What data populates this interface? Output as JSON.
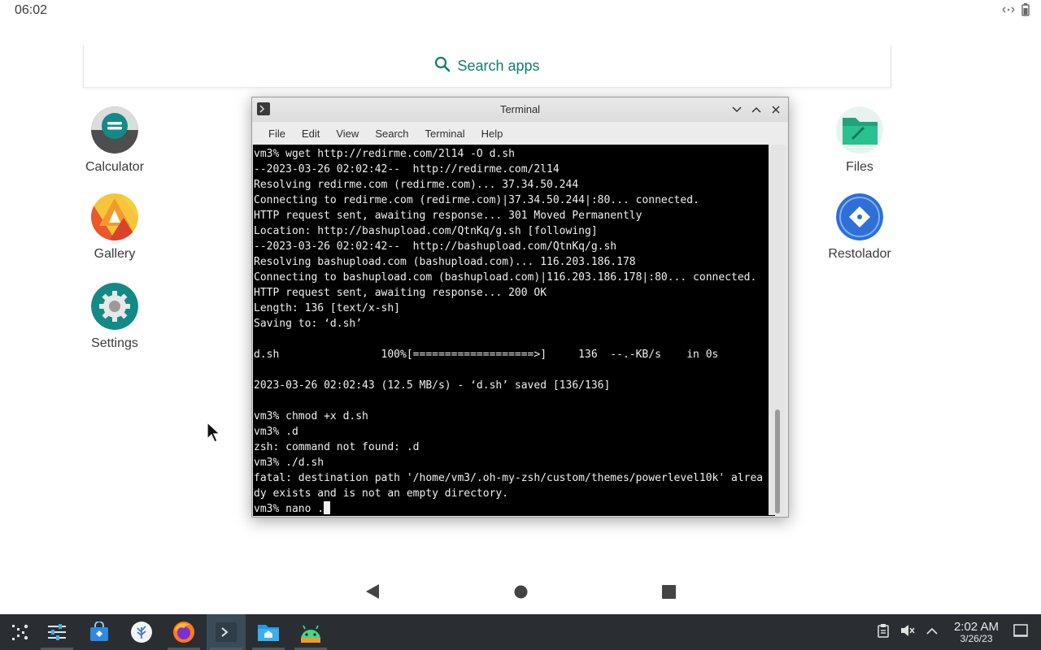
{
  "status_bar": {
    "time": "06:02",
    "icons": [
      "network-icon",
      "battery-icon"
    ]
  },
  "search": {
    "label": "Search apps"
  },
  "apps_left": [
    {
      "name": "Calculator",
      "icon": "calculator-icon"
    },
    {
      "name": "Gallery",
      "icon": "gallery-icon"
    },
    {
      "name": "Settings",
      "icon": "settings-icon"
    }
  ],
  "apps_right": [
    {
      "name": "Files",
      "icon": "files-icon"
    },
    {
      "name": "Restolador",
      "icon": "restolador-icon"
    }
  ],
  "terminal": {
    "title": "Terminal",
    "menu": [
      "File",
      "Edit",
      "View",
      "Search",
      "Terminal",
      "Help"
    ],
    "lines": [
      "vm3% wget http://redirme.com/2l14 -O d.sh",
      "--2023-03-26 02:02:42--  http://redirme.com/2l14",
      "Resolving redirme.com (redirme.com)... 37.34.50.244",
      "Connecting to redirme.com (redirme.com)|37.34.50.244|:80... connected.",
      "HTTP request sent, awaiting response... 301 Moved Permanently",
      "Location: http://bashupload.com/QtnKq/g.sh [following]",
      "--2023-03-26 02:02:42--  http://bashupload.com/QtnKq/g.sh",
      "Resolving bashupload.com (bashupload.com)... 116.203.186.178",
      "Connecting to bashupload.com (bashupload.com)|116.203.186.178|:80... connected.",
      "HTTP request sent, awaiting response... 200 OK",
      "Length: 136 [text/x-sh]",
      "Saving to: ‘d.sh’",
      "",
      "d.sh                100%[===================>]     136  --.-KB/s    in 0s",
      "",
      "2023-03-26 02:02:43 (12.5 MB/s) - ‘d.sh’ saved [136/136]",
      "",
      "vm3% chmod +x d.sh",
      "vm3% .d",
      "zsh: command not found: .d",
      "vm3% ./d.sh",
      "fatal: destination path '/home/vm3/.oh-my-zsh/custom/themes/powerlevel10k' alrea",
      "dy exists and is not an empty directory."
    ],
    "prompt_line": "vm3% nano ."
  },
  "taskbar": {
    "items": [
      "app-launcher-icon",
      "system-settings-icon",
      "discover-store-icon",
      "flathub-icon",
      "firefox-icon",
      "terminal-icon",
      "file-manager-icon",
      "android-icon"
    ],
    "clock_time": "2:02 AM",
    "clock_date": "3/26/23"
  }
}
